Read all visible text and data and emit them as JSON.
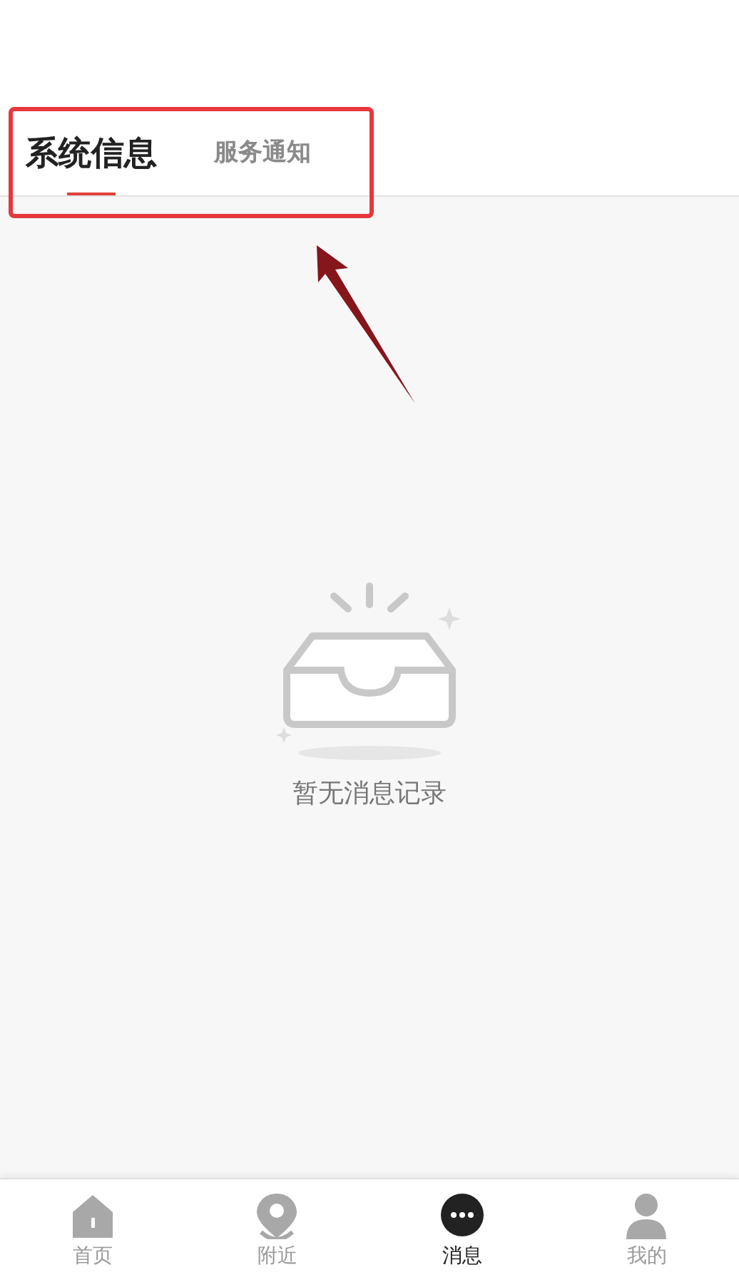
{
  "tabs": [
    {
      "label": "系统信息",
      "selected": true
    },
    {
      "label": "服务通知",
      "selected": false
    }
  ],
  "empty_state": {
    "message": "暂无消息记录"
  },
  "bottom_nav": [
    {
      "label": "首页",
      "kind": "home",
      "selected": false
    },
    {
      "label": "附近",
      "kind": "pin",
      "selected": false
    },
    {
      "label": "消息",
      "kind": "chat",
      "selected": true
    },
    {
      "label": "我的",
      "kind": "person",
      "selected": false
    }
  ]
}
